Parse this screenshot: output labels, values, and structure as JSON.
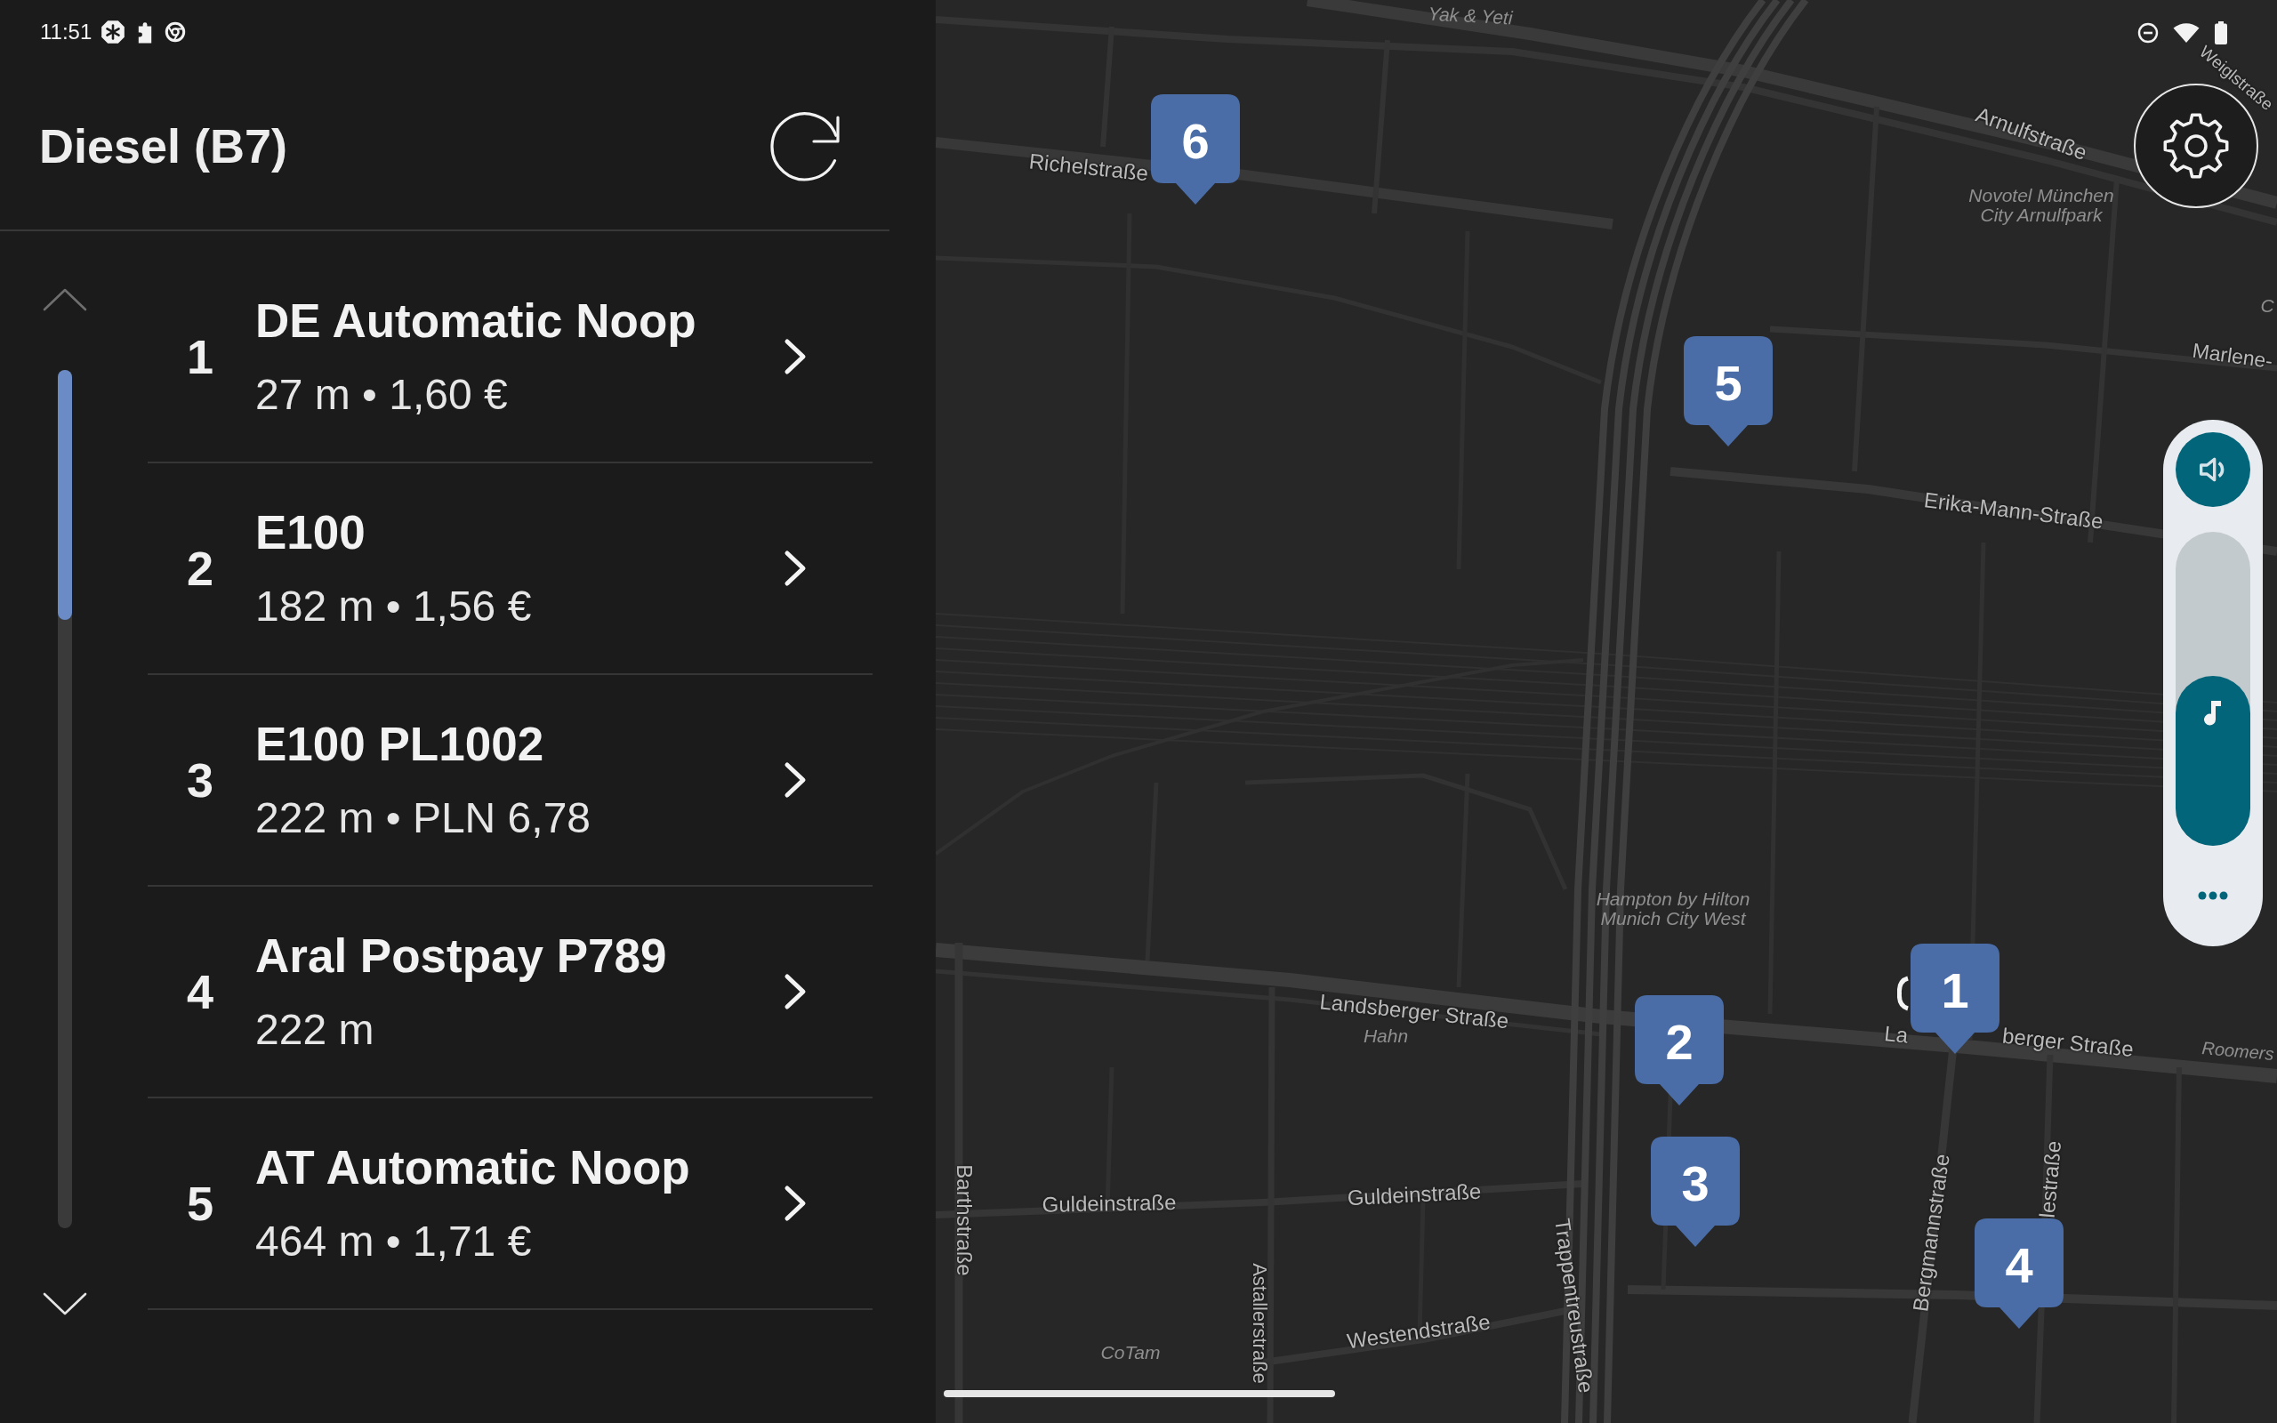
{
  "status_bar": {
    "time": "11:51"
  },
  "header": {
    "title": "Diesel (B7)"
  },
  "list": {
    "scroll_up": {
      "disabled": true
    },
    "scroll_down": {
      "disabled": false
    },
    "items": [
      {
        "number": "1",
        "name": "DE Automatic Noop",
        "details": "27 m • 1,60 €"
      },
      {
        "number": "2",
        "name": "E100",
        "details": "182 m • 1,56 €"
      },
      {
        "number": "3",
        "name": "E100 PL1002",
        "details": "222 m • PLN 6,78"
      },
      {
        "number": "4",
        "name": "Aral Postpay P789",
        "details": "222 m"
      },
      {
        "number": "5",
        "name": "AT Automatic Noop",
        "details": "464 m • 1,71 €"
      }
    ]
  },
  "map": {
    "labels": [
      {
        "kind": "poi",
        "lines": [
          "Yak & Yeti"
        ]
      },
      {
        "kind": "street",
        "lines": [
          "Weiglstraße"
        ]
      },
      {
        "kind": "street",
        "lines": [
          "Arnulfstraße"
        ]
      },
      {
        "kind": "street",
        "lines": [
          "Richelstraße"
        ]
      },
      {
        "kind": "poi",
        "lines": [
          "Novotel München",
          "City Arnulfpark"
        ]
      },
      {
        "kind": "poi",
        "lines": [
          "C"
        ]
      },
      {
        "kind": "street",
        "lines": [
          "Marlene-"
        ]
      },
      {
        "kind": "street",
        "lines": [
          "Erika-Mann-Straße"
        ]
      },
      {
        "kind": "poi",
        "lines": [
          "Hampton by Hilton",
          "Munich City West"
        ]
      },
      {
        "kind": "street",
        "lines": [
          "Landsberger Straße"
        ]
      },
      {
        "kind": "street",
        "lines": [
          "La"
        ]
      },
      {
        "kind": "poi",
        "lines": [
          "Hahn"
        ]
      },
      {
        "kind": "street",
        "lines": [
          "berger Straße"
        ]
      },
      {
        "kind": "poi",
        "lines": [
          "Roomers"
        ]
      },
      {
        "kind": "street",
        "lines": [
          "lestraße"
        ]
      },
      {
        "kind": "street",
        "lines": [
          "Guldeinstraße"
        ]
      },
      {
        "kind": "street",
        "lines": [
          "Guldeinstraße"
        ]
      },
      {
        "kind": "street",
        "lines": [
          "Barthstraße"
        ]
      },
      {
        "kind": "street",
        "lines": [
          "Bergmannstraße"
        ]
      },
      {
        "kind": "street",
        "lines": [
          "Trappentreustraße"
        ]
      },
      {
        "kind": "street",
        "lines": [
          "Westendstraße"
        ]
      },
      {
        "kind": "poi",
        "lines": [
          "CoTam"
        ]
      },
      {
        "kind": "street",
        "lines": [
          "Astallerstraße"
        ]
      }
    ],
    "pins": [
      {
        "number": "6"
      },
      {
        "number": "5"
      },
      {
        "number": "1"
      },
      {
        "number": "2"
      },
      {
        "number": "3"
      },
      {
        "number": "4"
      }
    ]
  },
  "volume": {
    "level": 0.54
  }
}
